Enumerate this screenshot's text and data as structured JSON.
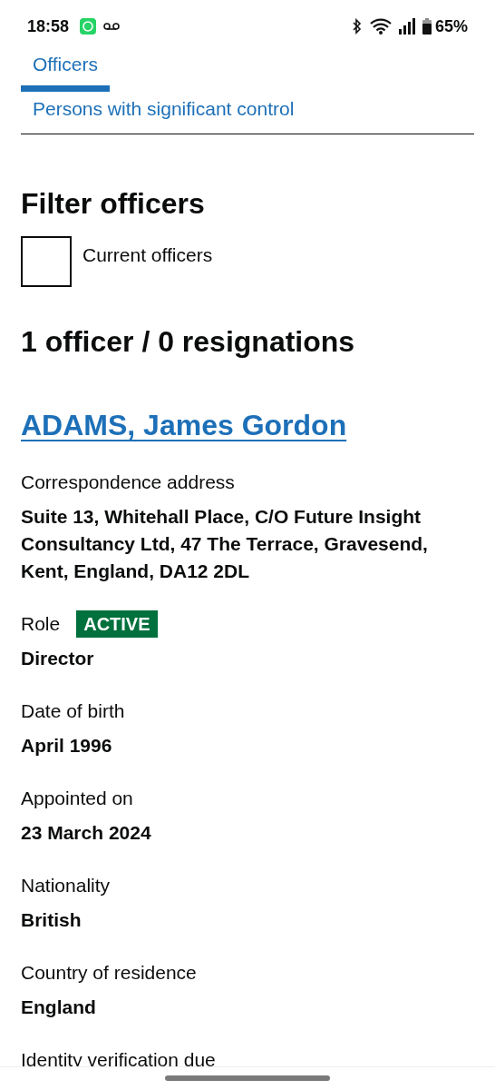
{
  "status_bar": {
    "time": "18:58",
    "battery": "65%"
  },
  "tabs": [
    {
      "label": "Officers",
      "selected": true
    },
    {
      "label": "Persons with significant control",
      "selected": false
    }
  ],
  "filter": {
    "heading": "Filter officers",
    "checkbox": {
      "label": "Current officers",
      "checked": false
    }
  },
  "summary": "1 officer / 0 resignations",
  "officer": {
    "name": "ADAMS, James Gordon",
    "details": [
      {
        "kind": "plain",
        "label": "Correspondence address",
        "value": "Suite 13, Whitehall Place, C/O Future Insight Consultancy Ltd, 47 The Terrace, Gravesend, Kent, England, DA12 2DL"
      },
      {
        "kind": "badge",
        "label": "Role",
        "badge": "ACTIVE",
        "value": "Director"
      },
      {
        "kind": "plain",
        "label": "Date of birth",
        "value": "April 1996"
      },
      {
        "kind": "plain",
        "label": "Appointed on",
        "value": "23 March 2024"
      },
      {
        "kind": "plain",
        "label": "Nationality",
        "value": "British"
      },
      {
        "kind": "plain",
        "label": "Country of residence",
        "value": "England"
      },
      {
        "kind": "label_only",
        "label": "Identity verification due"
      }
    ]
  }
}
